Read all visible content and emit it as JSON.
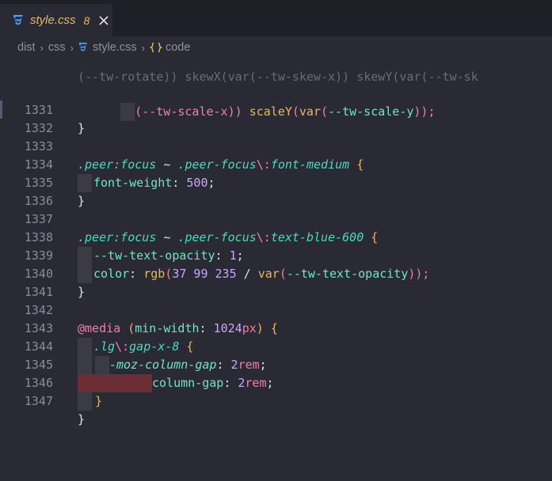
{
  "tab": {
    "file_name": "style.css",
    "problem_count": "8"
  },
  "breadcrumb": {
    "part1": "dist",
    "part2": "css",
    "part3": "style.css",
    "part4": "code"
  },
  "lines": {
    "partial_top": "(--tw-rotate)) skewX(var(--tw-skew-x)) skewY(var(--tw-sk",
    "partial": {
      "a": "(--tw-scale-x)) ",
      "b": "scaleY",
      "c": "(",
      "d": "var",
      "e": "(",
      "f": "--tw-scale-y",
      "g": "));"
    },
    "n1331": "1331",
    "n1332": "1332",
    "n1333": "1333",
    "n1334": "1334",
    "n1335": "1335",
    "n1336": "1336",
    "n1337": "1337",
    "n1338": "1338",
    "n1339": "1339",
    "n1340": "1340",
    "n1341": "1341",
    "n1342": "1342",
    "n1343": "1343",
    "n1344": "1344",
    "n1345": "1345",
    "n1346": "1346",
    "n1347": "1347",
    "close_brace": "}",
    "l1333": {
      "sel1": ".peer:focus",
      "op": " ~ ",
      "sel2": ".peer-focus",
      "esc": "\\:",
      "sel3": "font-medium",
      "brace": " {"
    },
    "l1334": {
      "prop": "font-weight",
      "colon": ": ",
      "num": "500",
      "semi": ";"
    },
    "l1337": {
      "sel1": ".peer:focus",
      "op": " ~ ",
      "sel2": ".peer-focus",
      "esc": "\\:",
      "sel3": "text-blue-600",
      "brace": " {"
    },
    "l1338": {
      "prop": "--tw-text-opacity",
      "colon": ": ",
      "num": "1",
      "semi": ";"
    },
    "l1339": {
      "prop": "color",
      "colon": ": ",
      "fn": "rgb",
      "p1": "(",
      "nums": "37 99 235",
      "slash": " / ",
      "fn2": "var",
      "p2": "(",
      "var": "--tw-text-opacity",
      "p3": "));"
    },
    "l1342": {
      "at": "@media",
      "p1": " (",
      "prop": "min-width",
      "colon": ": ",
      "num": "1024",
      "unit": "px",
      "p2": ")",
      "brace": " {"
    },
    "l1343": {
      "sel": ".lg",
      "esc": "\\:",
      "sel2": "gap-x-8",
      "brace": " {"
    },
    "l1344": {
      "prop": "-moz-column-gap",
      "colon": ": ",
      "num": "2",
      "unit": "rem",
      "semi": ";"
    },
    "l1345": {
      "prop": "column-gap",
      "colon": ": ",
      "num": "2",
      "unit": "rem",
      "semi": ";"
    }
  },
  "colors": {
    "accent_tab": "#e5b95c",
    "css_icon": "#3ea8ff",
    "bg": "#2a2a35",
    "error_mark": "#6b2e35"
  }
}
